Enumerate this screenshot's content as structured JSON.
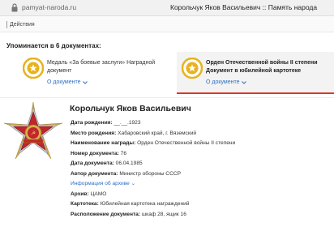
{
  "browser": {
    "url": "pamyat-naroda.ru",
    "page_title": "Корольчук Яков Васильевич :: Память народа"
  },
  "toolbar": {
    "actions_label": "Действия"
  },
  "mentions": {
    "header": "Упоминается в 6 документах:",
    "cards": [
      {
        "text": "Медаль «За боевые заслуги» Наградной документ",
        "link": "О документе",
        "selected": false
      },
      {
        "text": "Орден Отечественной войны II степени Документ в юбилейной картотеке",
        "link": "О документе",
        "selected": true
      }
    ]
  },
  "person": {
    "name": "Корольчук Яков Васильевич",
    "fields": [
      {
        "label": "Дата рождения:",
        "value": "__.__.1923"
      },
      {
        "label": "Место рождения:",
        "value": "Хабаровский край, г. Вяземский"
      },
      {
        "label": "Наименование награды:",
        "value": "Орден Отечественной войны II степени"
      },
      {
        "label": "Номер документа:",
        "value": "76"
      },
      {
        "label": "Дата документа:",
        "value": "06.04.1985"
      },
      {
        "label": "Автор документа:",
        "value": "Министр обороны СССР"
      }
    ],
    "archive_info_link": "Информация об архиве",
    "archive_fields": [
      {
        "label": "Архив:",
        "value": "ЦАМО"
      },
      {
        "label": "Картотека:",
        "value": "Юбилейная картотека награждений"
      },
      {
        "label": "Расположение документа:",
        "value": "шкаф 28, ящик 16"
      }
    ]
  },
  "colors": {
    "link": "#2f6fc4",
    "accent_red": "#d9392b",
    "medal_gold": "#e8b21c"
  },
  "icons": [
    "lock-icon",
    "medal-icon",
    "chevron-down-icon",
    "order-image"
  ]
}
